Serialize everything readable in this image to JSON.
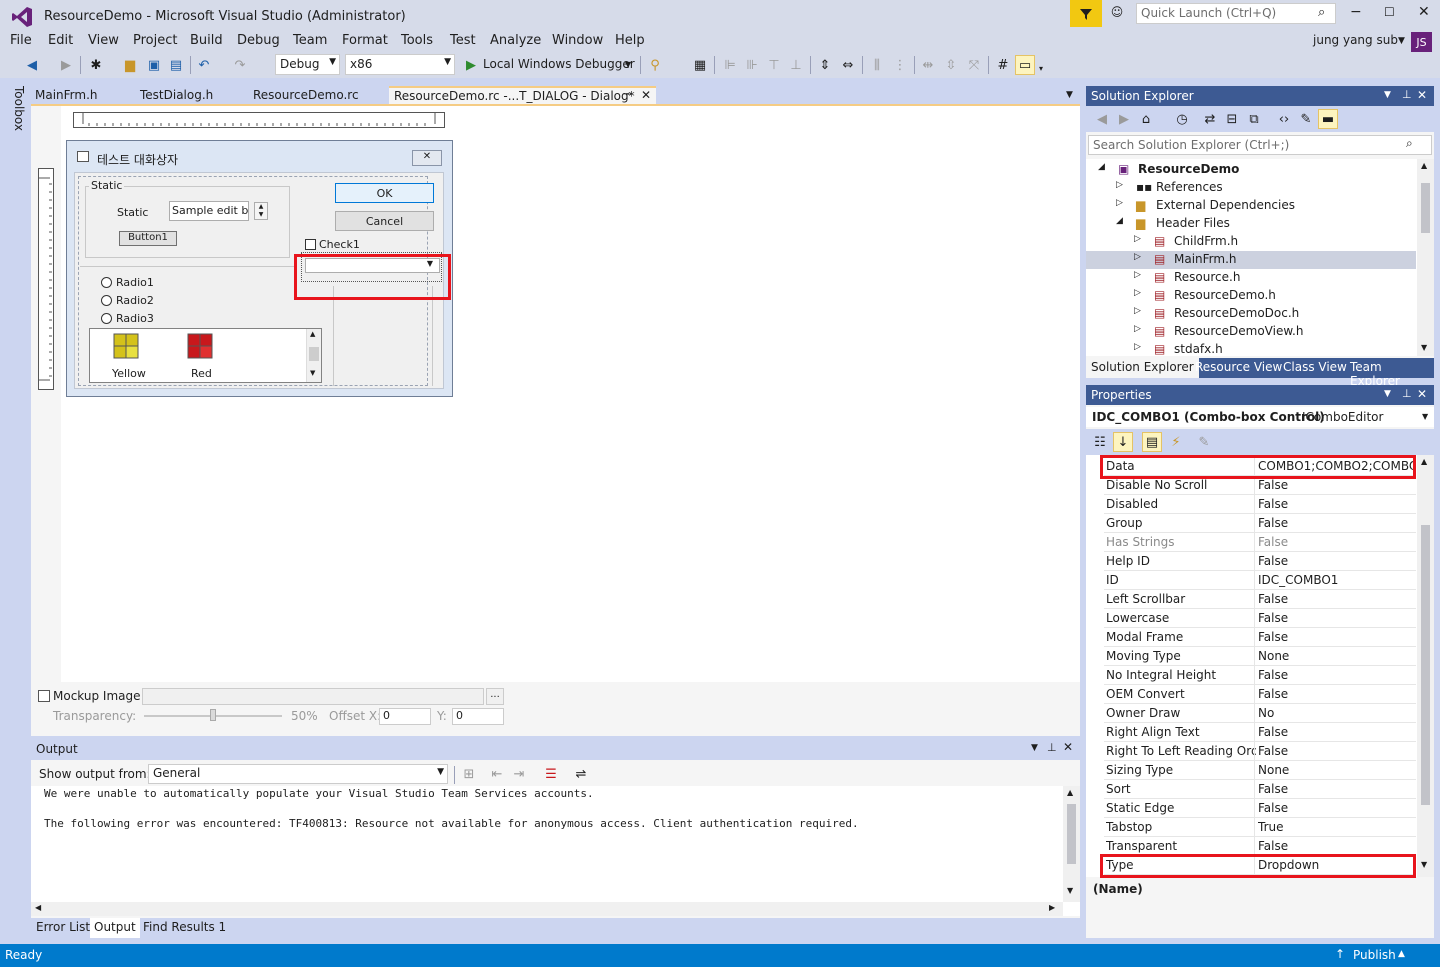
{
  "window": {
    "title": "ResourceDemo - Microsoft Visual Studio (Administrator)",
    "quick_launch_placeholder": "Quick Launch (Ctrl+Q)",
    "user_name": "jung yang sub",
    "user_initials": "JS"
  },
  "menu": [
    "File",
    "Edit",
    "View",
    "Project",
    "Build",
    "Debug",
    "Team",
    "Format",
    "Tools",
    "Test",
    "Analyze",
    "Window",
    "Help"
  ],
  "toolbar": {
    "config": "Debug",
    "platform": "x86",
    "debugger": "Local Windows Debugger"
  },
  "toolbox_label": "Toolbox",
  "doc_tabs": [
    "MainFrm.h",
    "TestDialog.h",
    "ResourceDemo.rc",
    "ResourceDemo.rc -...T_DIALOG - Dialog*"
  ],
  "dialog": {
    "title": "테스트 대화상자",
    "group_label": "Static",
    "static_label": "Static",
    "edit_value": "Sample edit box",
    "button1": "Button1",
    "ok": "OK",
    "cancel": "Cancel",
    "check1": "Check1",
    "radios": [
      "Radio1",
      "Radio2",
      "Radio3"
    ],
    "list_items": [
      "Yellow",
      "Red"
    ]
  },
  "mockup": {
    "label": "Mockup Image",
    "browse": "...",
    "transparency_label": "Transparency:",
    "transparency_value": "50%",
    "offset_x_label": "Offset X:",
    "offset_x": "0",
    "y_label": "Y:",
    "y": "0"
  },
  "output": {
    "title": "Output",
    "show_from_label": "Show output from:",
    "source": "General",
    "lines": [
      "We were unable to automatically populate your Visual Studio Team Services accounts.",
      "",
      "The following error was encountered: TF400813: Resource not available for anonymous access. Client authentication required."
    ],
    "tabs": [
      "Error List",
      "Output",
      "Find Results 1"
    ]
  },
  "solution_explorer": {
    "title": "Solution Explorer",
    "search_placeholder": "Search Solution Explorer (Ctrl+;)",
    "items": [
      {
        "label": "ResourceDemo",
        "level": 0,
        "bold": true
      },
      {
        "label": "References",
        "level": 1
      },
      {
        "label": "External Dependencies",
        "level": 1
      },
      {
        "label": "Header Files",
        "level": 1
      },
      {
        "label": "ChildFrm.h",
        "level": 2
      },
      {
        "label": "MainFrm.h",
        "level": 2,
        "selected": true
      },
      {
        "label": "Resource.h",
        "level": 2
      },
      {
        "label": "ResourceDemo.h",
        "level": 2
      },
      {
        "label": "ResourceDemoDoc.h",
        "level": 2
      },
      {
        "label": "ResourceDemoView.h",
        "level": 2
      },
      {
        "label": "stdafx.h",
        "level": 2
      }
    ],
    "tabs": [
      "Solution Explorer",
      "Resource View",
      "Class View",
      "Team Explorer"
    ]
  },
  "properties": {
    "title": "Properties",
    "object": "IDC_COMBO1 (Combo-box Control)",
    "editor": "IComboEditor",
    "rows": [
      {
        "name": "Data",
        "value": "COMBO1;COMBO2;COMBO"
      },
      {
        "name": "Disable No Scroll",
        "value": "False"
      },
      {
        "name": "Disabled",
        "value": "False"
      },
      {
        "name": "Group",
        "value": "False"
      },
      {
        "name": "Has Strings",
        "value": "False",
        "gray": true
      },
      {
        "name": "Help ID",
        "value": "False"
      },
      {
        "name": "ID",
        "value": "IDC_COMBO1"
      },
      {
        "name": "Left Scrollbar",
        "value": "False"
      },
      {
        "name": "Lowercase",
        "value": "False"
      },
      {
        "name": "Modal Frame",
        "value": "False"
      },
      {
        "name": "Moving Type",
        "value": "None"
      },
      {
        "name": "No Integral Height",
        "value": "False"
      },
      {
        "name": "OEM Convert",
        "value": "False"
      },
      {
        "name": "Owner Draw",
        "value": "No"
      },
      {
        "name": "Right Align Text",
        "value": "False"
      },
      {
        "name": "Right To Left Reading Orde",
        "value": "False"
      },
      {
        "name": "Sizing Type",
        "value": "None"
      },
      {
        "name": "Sort",
        "value": "False"
      },
      {
        "name": "Static Edge",
        "value": "False"
      },
      {
        "name": "Tabstop",
        "value": "True"
      },
      {
        "name": "Transparent",
        "value": "False"
      },
      {
        "name": "Type",
        "value": "Dropdown"
      }
    ],
    "description": "(Name)"
  },
  "status": {
    "left": "Ready",
    "right": "Publish"
  },
  "colors": {
    "accent": "#007acc",
    "highlight": "#e8141c",
    "vs_purple": "#68217a"
  }
}
